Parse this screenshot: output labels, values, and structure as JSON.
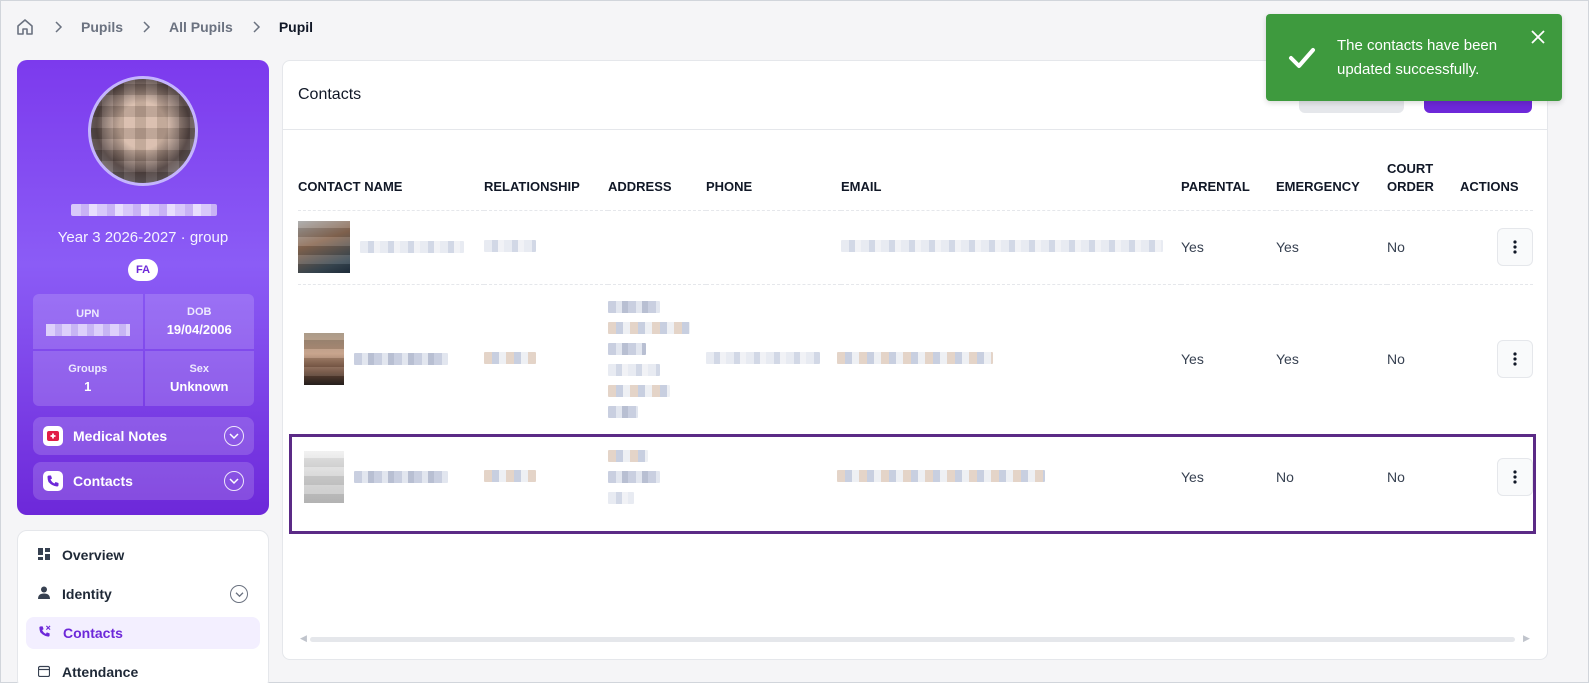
{
  "breadcrumb": {
    "items": [
      "Pupils",
      "All Pupils",
      "Pupil"
    ]
  },
  "profile": {
    "year_group": "Year 3 2026-2027 · group",
    "badge": "FA",
    "stats": {
      "upn_label": "UPN",
      "dob_label": "DOB",
      "dob_value": "19/04/2006",
      "groups_label": "Groups",
      "groups_value": "1",
      "sex_label": "Sex",
      "sex_value": "Unknown"
    },
    "accordions": {
      "medical": "Medical Notes",
      "contacts": "Contacts"
    }
  },
  "nav": {
    "items": [
      {
        "label": "Overview",
        "icon": "dashboard-icon"
      },
      {
        "label": "Identity",
        "icon": "person-icon"
      },
      {
        "label": "Contacts",
        "icon": "phone-icon",
        "active": true
      },
      {
        "label": "Attendance",
        "icon": "calendar-icon"
      }
    ]
  },
  "panel": {
    "title": "Contacts",
    "columns": [
      "Contact Name",
      "Relationship",
      "Address",
      "Phone",
      "Email",
      "Parental",
      "Emergency",
      "Court Order",
      "Actions"
    ],
    "rows": [
      {
        "parental": "Yes",
        "emergency": "Yes",
        "court_order": "No"
      },
      {
        "parental": "Yes",
        "emergency": "Yes",
        "court_order": "No"
      },
      {
        "parental": "Yes",
        "emergency": "No",
        "court_order": "No"
      }
    ]
  },
  "toast": {
    "message": "The contacts have been updated successfully."
  },
  "colors": {
    "brand": "#6d28d9",
    "success": "#3e9a3e",
    "highlight": "#5b2a86"
  }
}
